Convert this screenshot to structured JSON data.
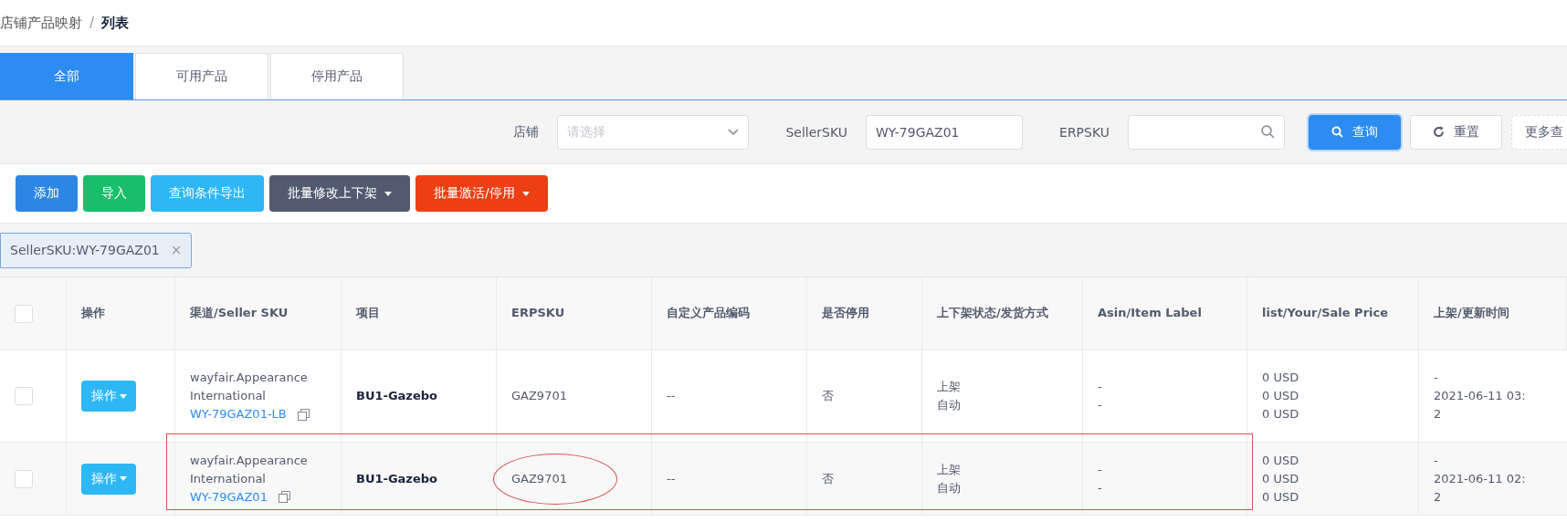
{
  "breadcrumb": {
    "items": [
      {
        "label": "店铺产品映射",
        "current": false
      },
      {
        "label": "列表",
        "current": true
      }
    ],
    "separator": "/"
  },
  "tabs": [
    {
      "label": "全部",
      "selected": true
    },
    {
      "label": "可用产品",
      "selected": false
    },
    {
      "label": "停用产品",
      "selected": false
    }
  ],
  "filters": {
    "store": {
      "label": "店铺",
      "placeholder": "请选择"
    },
    "seller_sku": {
      "label": "SellerSKU",
      "value": "WY-79GAZ01"
    },
    "erpsku": {
      "label": "ERPSKU"
    }
  },
  "search_buttons": [
    {
      "kind": "primary",
      "label": "查询"
    },
    {
      "kind": "default",
      "label": "重置"
    },
    {
      "kind": "dashed",
      "label": "更多查"
    }
  ],
  "actions": [
    {
      "label": "添加",
      "color": "#2d86e3",
      "dropdown": false
    },
    {
      "label": "导入",
      "color": "#19be6b",
      "dropdown": false
    },
    {
      "label": "查询条件导出",
      "color": "#2db7f5",
      "dropdown": false
    },
    {
      "label": "批量修改上下架",
      "color": "#515a6e",
      "dropdown": true
    },
    {
      "label": "批量激活/停用",
      "color": "#ed3f14",
      "dropdown": true
    }
  ],
  "active_filters": [
    {
      "label": "SellerSKU:WY-79GAZ01",
      "close": "×"
    }
  ],
  "table": {
    "header_checked": false,
    "columns": [
      "操作",
      "渠道/Seller SKU",
      "项目",
      "ERPSKU",
      "自定义产品编码",
      "是否停用",
      "上下架状态/发货方式",
      "Asin/Item Label",
      "list/Your/Sale Price",
      "上架/更新时间"
    ],
    "rows": [
      {
        "checked": false,
        "action": "操作",
        "channel": "wayfair.Appearance International",
        "seller_sku": "WY-79GAZ01-LB",
        "project": "BU1-Gazebo",
        "erpsku": "GAZ9701",
        "custom_code": "--",
        "disabled": "否",
        "listing": [
          "上架",
          "自动"
        ],
        "asin": [
          "-",
          "-"
        ],
        "prices": [
          "0 USD",
          "0 USD",
          "0 USD"
        ],
        "times": [
          "-",
          "2021-06-11 03:",
          "2"
        ],
        "outlined": false,
        "erpsku_circled": false
      },
      {
        "checked": false,
        "action": "操作",
        "channel": "wayfair.Appearance International",
        "seller_sku": "WY-79GAZ01",
        "project": "BU1-Gazebo",
        "erpsku": "GAZ9701",
        "custom_code": "--",
        "disabled": "否",
        "listing": [
          "上架",
          "自动"
        ],
        "asin": [
          "-",
          "-"
        ],
        "prices": [
          "0 USD",
          "0 USD",
          "0 USD"
        ],
        "times": [
          "-",
          "2021-06-11 02:",
          "2"
        ],
        "outlined": true,
        "erpsku_circled": true
      }
    ]
  }
}
